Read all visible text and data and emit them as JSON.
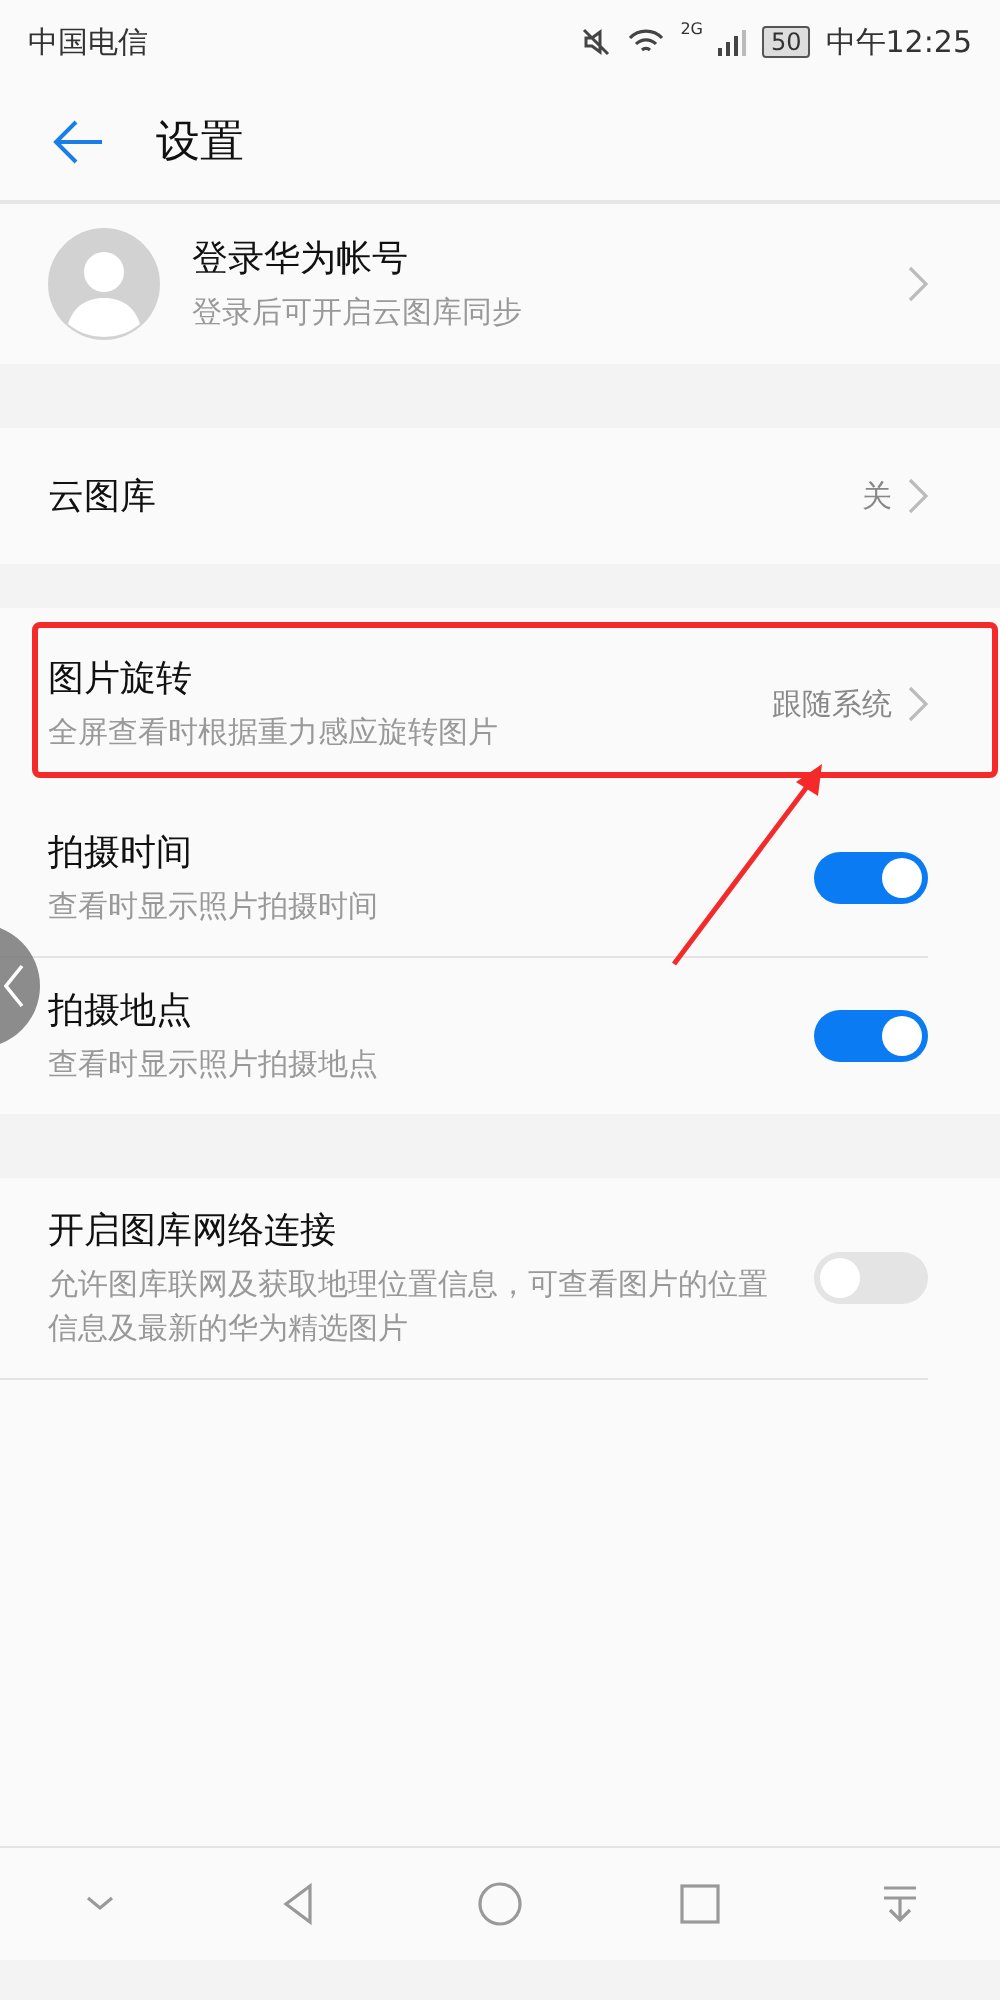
{
  "status_bar": {
    "carrier": "中国电信",
    "network": "2G",
    "battery": "50",
    "time": "中午12:25"
  },
  "header": {
    "title": "设置"
  },
  "account": {
    "title": "登录华为帐号",
    "subtitle": "登录后可开启云图库同步"
  },
  "groups": [
    {
      "items": [
        {
          "kind": "value",
          "title": "云图库",
          "value": "关"
        }
      ]
    },
    {
      "items": [
        {
          "kind": "value",
          "title": "图片旋转",
          "subtitle": "全屏查看时根据重力感应旋转图片",
          "value": "跟随系统",
          "highlighted": true
        },
        {
          "kind": "toggle",
          "title": "拍摄时间",
          "subtitle": "查看时显示照片拍摄时间",
          "on": true
        },
        {
          "kind": "toggle",
          "title": "拍摄地点",
          "subtitle": "查看时显示照片拍摄地点",
          "on": true
        }
      ]
    },
    {
      "items": [
        {
          "kind": "toggle",
          "title": "开启图库网络连接",
          "subtitle": "允许图库联网及获取地理位置信息，可查看图片的位置信息及最新的华为精选图片",
          "on": false
        }
      ]
    }
  ]
}
